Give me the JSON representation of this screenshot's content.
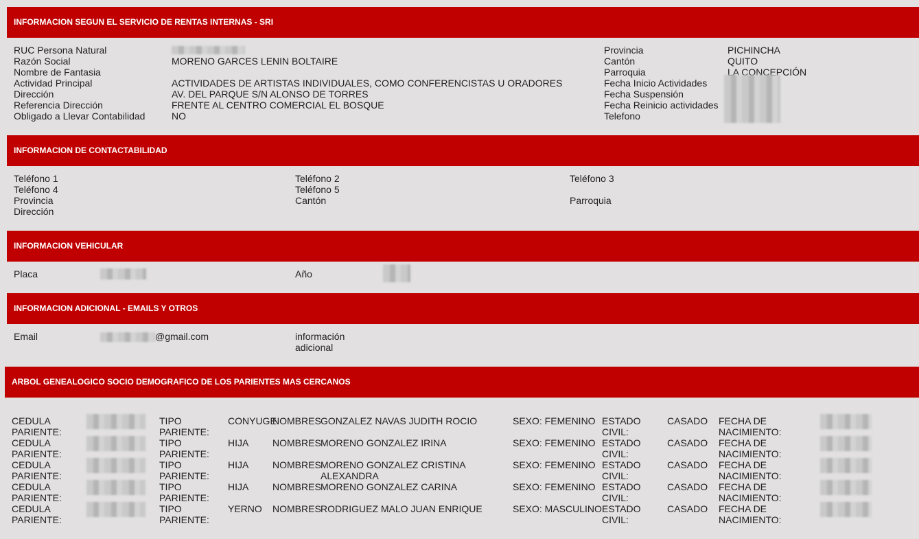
{
  "sections": {
    "sri": "INFORMACION SEGUN EL SERVICIO DE RENTAS INTERNAS - SRI",
    "contact": "INFORMACION DE CONTACTABILIDAD",
    "vehicle": "INFORMACION VEHICULAR",
    "additional": "INFORMACION ADICIONAL - EMAILS Y OTROS",
    "genealogy": "ARBOL GENEALOGICO SOCIO DEMOGRAFICO DE LOS PARIENTES MAS CERCANOS"
  },
  "sri": {
    "left": [
      {
        "label": "RUC Persona Natural",
        "value": ""
      },
      {
        "label": "Razón Social",
        "value": "MORENO GARCES LENIN BOLTAIRE"
      },
      {
        "label": "Nombre de Fantasia",
        "value": ""
      },
      {
        "label": "Actividad Principal",
        "value": "ACTIVIDADES DE ARTISTAS INDIVIDUALES, COMO CONFERENCISTAS U ORADORES"
      },
      {
        "label": "Dirección",
        "value": "AV. DEL PARQUE S/N ALONSO DE TORRES"
      },
      {
        "label": "Referencia Dirección",
        "value": "FRENTE AL CENTRO COMERCIAL EL BOSQUE"
      },
      {
        "label": "Obligado a Llevar Contabilidad",
        "value": "NO"
      }
    ],
    "right": [
      {
        "label": "Provincia",
        "value": "PICHINCHA"
      },
      {
        "label": "Cantón",
        "value": "QUITO"
      },
      {
        "label": "Parroquia",
        "value": "LA CONCEPCIÓN"
      },
      {
        "label": "Fecha Inicio Actividades",
        "value": ""
      },
      {
        "label": "Fecha Suspensión",
        "value": ""
      },
      {
        "label": "Fecha Reinicio actividades",
        "value": ""
      },
      {
        "label": "Telefono",
        "value": ""
      }
    ]
  },
  "contact": {
    "telefono1": "Teléfono 1",
    "telefono2": "Teléfono 2",
    "telefono3": "Teléfono 3",
    "telefono4": "Teléfono 4",
    "telefono5": "Teléfono 5",
    "provincia": "Provincia",
    "canton": "Cantón",
    "parroquia": "Parroquia",
    "direccion": "Dirección"
  },
  "vehicle": {
    "placa_label": "Placa",
    "anio_label": "Año"
  },
  "additional": {
    "email_label": "Email",
    "email_domain": "@gmail.com",
    "info_label_1": "información",
    "info_label_2": "adicional"
  },
  "genealogy": {
    "labels": {
      "cedula_1": "CEDULA",
      "cedula_2": "PARIENTE:",
      "tipo_1": "TIPO",
      "tipo_2": "PARIENTE:",
      "nombres": "NOMBRES",
      "estado_1": "ESTADO",
      "estado_2": "CIVIL:",
      "fecha_1": "FECHA DE",
      "fecha_2": "NACIMIENTO:"
    },
    "rows": [
      {
        "tipo": "CONYUGE",
        "nombre_1": "GONZALEZ NAVAS JUDITH ROCIO",
        "nombre_2": "",
        "sexo": "SEXO: FEMENINO",
        "estado": "CASADO"
      },
      {
        "tipo": "HIJA",
        "nombre_1": "MORENO GONZALEZ IRINA",
        "nombre_2": "",
        "sexo": "SEXO: FEMENINO",
        "estado": "CASADO"
      },
      {
        "tipo": "HIJA",
        "nombre_1": "MORENO GONZALEZ CRISTINA",
        "nombre_2": "ALEXANDRA",
        "sexo": "SEXO: FEMENINO",
        "estado": "CASADO"
      },
      {
        "tipo": "HIJA",
        "nombre_1": "MORENO GONZALEZ CARINA",
        "nombre_2": "",
        "sexo": "SEXO: FEMENINO",
        "estado": "CASADO"
      },
      {
        "tipo": "YERNO",
        "nombre_1": "RODRIGUEZ MALO JUAN ENRIQUE",
        "nombre_2": "",
        "sexo": "SEXO: MASCULINO",
        "estado": "CASADO"
      }
    ]
  }
}
